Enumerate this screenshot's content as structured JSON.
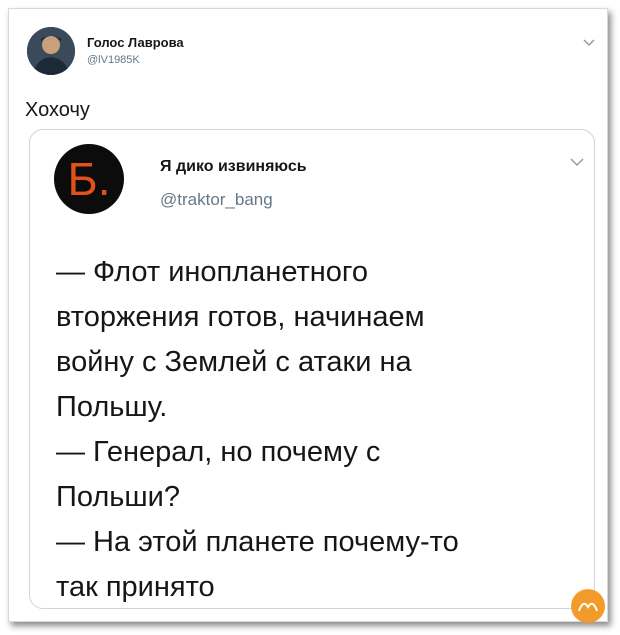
{
  "outer_tweet": {
    "author_name": "Голос Лаврова",
    "author_handle": "@lV1985K",
    "text": "Хохочу"
  },
  "quoted_tweet": {
    "avatar_letter": "Б.",
    "author_name": "Я дико извиняюсь",
    "author_handle": "@traktor_bang",
    "lines": [
      "— Флот инопланетного",
      "вторжения готов, начинаем",
      "войну с Землей с атаки на",
      "Польшу.",
      "— Генерал, но почему с",
      "Польши?",
      "— На этой планете почему-то",
      "так принято"
    ]
  },
  "icons": {
    "outer_menu": "chevron-down-icon",
    "quote_menu": "chevron-down-icon"
  },
  "colors": {
    "text": "#14171a",
    "secondary": "#657786",
    "border": "#ccd6dd",
    "avatar_letter": "#e1521a",
    "avatar_bg": "#0c0c0c"
  }
}
